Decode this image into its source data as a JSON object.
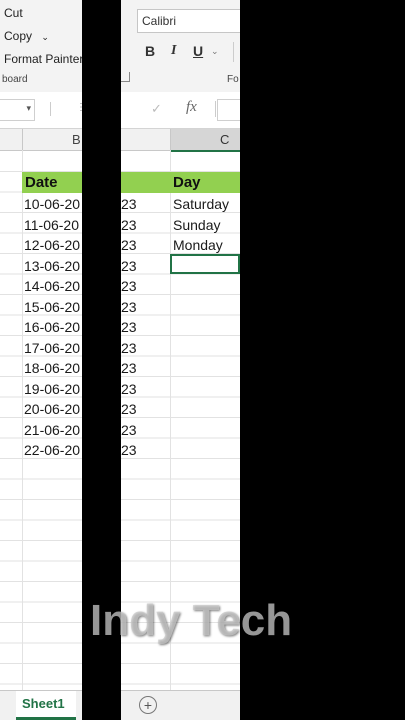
{
  "clipboard": {
    "cut": "Cut",
    "copy": "Copy",
    "format_painter": "Format Painter",
    "group_label": "board"
  },
  "font": {
    "name_value": "Calibri",
    "group_label": "Fo",
    "bold": "B",
    "italic": "I",
    "underline": "U"
  },
  "formula_bar": {
    "fx": "fx"
  },
  "columns": {
    "b": "B",
    "c": "C"
  },
  "table": {
    "header_date": "Date",
    "header_day": "Day",
    "dates_left": [
      "10-06-20",
      "11-06-20",
      "12-06-20",
      "13-06-20",
      "14-06-20",
      "15-06-20",
      "16-06-20",
      "17-06-20",
      "18-06-20",
      "19-06-20",
      "20-06-20",
      "21-06-20",
      "22-06-20"
    ],
    "dates_right": [
      "23",
      "23",
      "23",
      "23",
      "23",
      "23",
      "23",
      "23",
      "23",
      "23",
      "23",
      "23",
      "23"
    ],
    "days": [
      "Saturday",
      "Sunday",
      "Monday"
    ]
  },
  "sheet_tab": "Sheet1",
  "watermark": "Indy Tech",
  "colors": {
    "header_fill": "#92d050",
    "selection": "#217346",
    "tab_active": "#217346"
  }
}
